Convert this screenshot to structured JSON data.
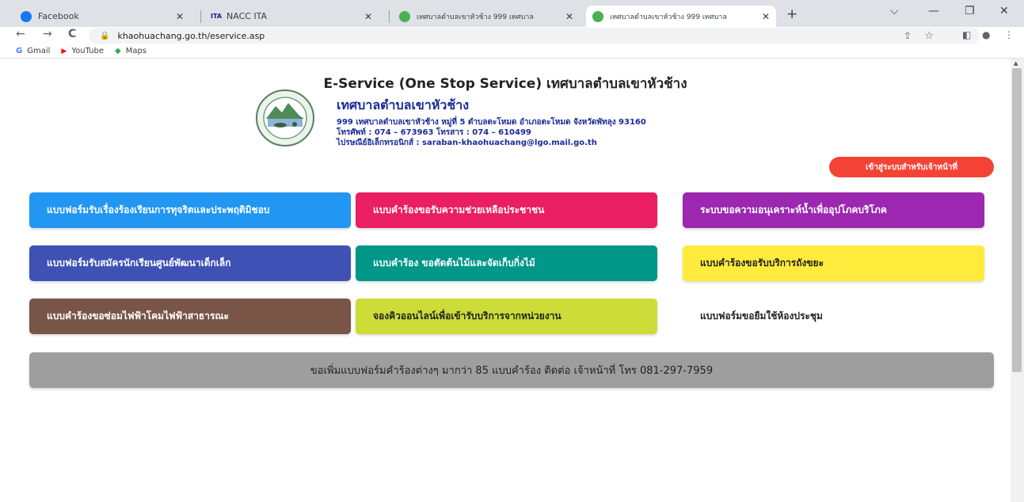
{
  "browser": {
    "tabs": [
      {
        "title": "Facebook",
        "close": "✕",
        "favicon_color": "#1877f2"
      },
      {
        "title": "NACC ITA",
        "close": "✕",
        "favicon_color": "#1a237e",
        "favicon_label": "ITA"
      },
      {
        "title": "เทศบาลตำบลเขาหัวช้าง 999 เทศบาล",
        "close": "✕",
        "favicon_color": "#4caf50"
      },
      {
        "title": "เทศบาลตำบลเขาหัวช้าง 999 เทศบาล",
        "close": "✕",
        "favicon_color": "#4caf50",
        "active": true
      }
    ],
    "new_tab": "+",
    "window_controls": {
      "dropdown": "⌵",
      "minimize": "—",
      "restore": "❐",
      "close": "✕"
    },
    "nav": {
      "back": "←",
      "forward": "→",
      "reload": "C"
    },
    "url": "khaohuachang.go.th/eservice.asp",
    "bookmarks": [
      {
        "label": "Gmail",
        "icon": "G",
        "color": "#4285f4"
      },
      {
        "label": "YouTube",
        "icon": "▶",
        "color": "#ff0000"
      },
      {
        "label": "Maps",
        "icon": "◆",
        "color": "#34a853"
      }
    ]
  },
  "page": {
    "title": "E-Service (One Stop Service) เทศบาลตำบลเขาหัวช้าง",
    "org": {
      "name": "เทศบาลตำบลเขาหัวช้าง",
      "address": "999 เทศบาลตำบลเขาหัวช้าง หมู่ที่ 5 ตำบลตะโหมด อำเภอตะโหมด จังหวัดพัทลุง 93160",
      "phone": "โทรศัพท์ : 074 – 673963 โทรสาร : 074 – 610499",
      "email": "ไปรษณีย์อิเล็กทรอนิกส์ : saraban-khaohuachang@lgo.mail.go.th"
    },
    "staff_login": "เข้าสู่ระบบสำหรับเจ้าหน้าที่",
    "services": [
      {
        "label": "แบบฟอร์มรับเรื่องร้องเรียนการทุจริตและประพฤติมิชอบ",
        "color": "#2196f3",
        "text_color": "#ffffff"
      },
      {
        "label": "แบบคำร้องขอรับความช่วยเหลือประชาชน",
        "color": "#e91e63",
        "text_color": "#ffffff"
      },
      {
        "label": "ระบบขอความอนุเคราะห์น้ำเพื่ออุปโภคบริโภค",
        "color": "#9c27b0",
        "text_color": "#ffffff"
      },
      {
        "label": "แบบฟอร์มรับสมัครนักเรียนศูนย์พัฒนาเด็กเล็ก",
        "color": "#3f51b5",
        "text_color": "#ffffff"
      },
      {
        "label": "แบบคำร้อง ขอตัดต้นไม้และจัดเก็บกิ่งไม้",
        "color": "#009688",
        "text_color": "#ffffff"
      },
      {
        "label": "แบบคำร้องขอรับบริการถังขยะ",
        "color": "#ffeb3b",
        "text_color": "#222222"
      },
      {
        "label": "แบบคำร้องขอซ่อมไฟฟ้าโคมไฟฟ้าสาธารณะ",
        "color": "#795548",
        "text_color": "#ffffff"
      },
      {
        "label": "จองคิวออนไลน์เพื่อเข้ารับบริการจากหน่วยงาน",
        "color": "#cddc39",
        "text_color": "#222222"
      },
      {
        "label": "แบบฟอร์มขอยืมใช้ห้องประชุม",
        "color": "",
        "text_color": "#222222"
      }
    ],
    "more_forms": "ขอเพิ่มแบบฟอร์มคำร้องต่างๆ มากว่า 85 แบบคำร้อง ติดต่อ เจ้าหน้าที่ โทร 081-297-7959"
  }
}
